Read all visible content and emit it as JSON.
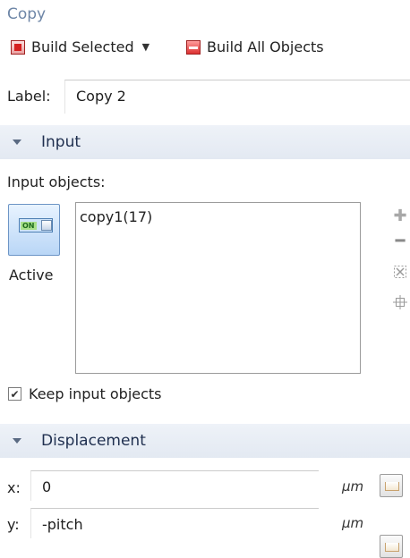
{
  "header": {
    "title": "Copy",
    "build_selected_label": "Build Selected",
    "build_all_label": "Build All Objects"
  },
  "label_row": {
    "label": "Label:",
    "value": "Copy 2"
  },
  "input_section": {
    "title": "Input",
    "objects_label": "Input objects:",
    "active_label": "Active",
    "toggle_text": "ON",
    "items": [
      "copy1(17)"
    ],
    "keep_label": "Keep input objects",
    "keep_checked": true,
    "tools": [
      "add-icon",
      "remove-icon",
      "clear-selection-icon",
      "zoom-to-selection-icon"
    ]
  },
  "displacement_section": {
    "title": "Displacement",
    "x_label": "x:",
    "x_value": "0",
    "x_unit": "μm",
    "y_label": "y:",
    "y_value": "-pitch",
    "y_unit": "μm"
  }
}
